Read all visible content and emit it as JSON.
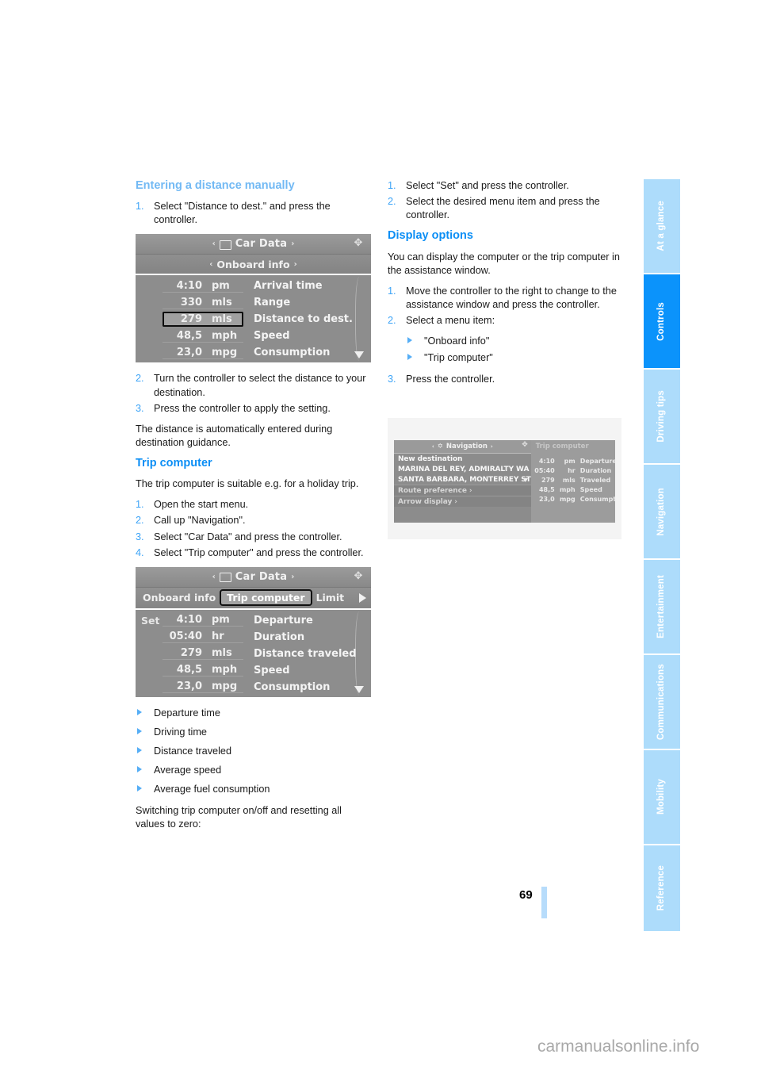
{
  "page": {
    "number": "69",
    "watermark": "carmanualsonline.info"
  },
  "side_tabs": [
    {
      "label": "At a glance",
      "active": false
    },
    {
      "label": "Controls",
      "active": true
    },
    {
      "label": "Driving tips",
      "active": false
    },
    {
      "label": "Navigation",
      "active": false
    },
    {
      "label": "Entertainment",
      "active": false
    },
    {
      "label": "Communications",
      "active": false
    },
    {
      "label": "Mobility",
      "active": false
    },
    {
      "label": "Reference",
      "active": false
    }
  ],
  "left_column": {
    "heading_entering": "Entering a distance manually",
    "steps_entering_1": [
      "Select \"Distance to dest.\" and press the controller."
    ],
    "steps_entering_2": [
      "Turn the controller to select the distance to your destination.",
      "Press the controller to apply the setting."
    ],
    "para_distance_auto": "The distance is automatically entered during destination guidance.",
    "heading_trip": "Trip computer",
    "para_trip_intro": "The trip computer is suitable e.g. for a holiday trip.",
    "steps_trip": [
      "Open the start menu.",
      "Call up \"Navigation\".",
      "Select \"Car Data\" and press the controller.",
      "Select \"Trip computer\" and press the controller."
    ],
    "trip_values": [
      "Departure time",
      "Driving time",
      "Distance traveled",
      "Average speed",
      "Average fuel consumption"
    ],
    "para_switching": "Switching trip computer on/off and resetting all values to zero:"
  },
  "right_column": {
    "steps_set": [
      "Select \"Set\" and press the controller.",
      "Select the desired menu item and press the controller."
    ],
    "heading_display": "Display options",
    "para_display": "You can display the computer or the trip computer in the assistance window.",
    "steps_display": [
      "Move the controller to the right to change to the assistance window and press the controller.",
      "Select a menu item:",
      "Press the controller."
    ],
    "menu_items": [
      "\"Onboard info\"",
      "\"Trip computer\""
    ]
  },
  "screens": {
    "onboard_info": {
      "title": "Car Data",
      "subtitle": "Onboard info",
      "caret_left": "‹",
      "caret_right": "›",
      "rows": [
        {
          "value": "4:10",
          "unit": "pm",
          "label": "Arrival time",
          "highlight": false
        },
        {
          "value": "330",
          "unit": "mls",
          "label": "Range",
          "highlight": false
        },
        {
          "value": "279",
          "unit": "mls",
          "label": "Distance to dest.",
          "highlight": true
        },
        {
          "value": "48,5",
          "unit": "mph",
          "label": "Speed",
          "highlight": false
        },
        {
          "value": "23,0",
          "unit": "mpg",
          "label": "Consumption",
          "highlight": false
        }
      ]
    },
    "trip_computer": {
      "title": "Car Data",
      "tabs": [
        "Onboard info",
        "Trip computer",
        "Limit"
      ],
      "selected_tab": "Trip computer",
      "set_label": "Set",
      "rows": [
        {
          "value": "4:10",
          "unit": "pm",
          "label": "Departure"
        },
        {
          "value": "05:40",
          "unit": "hr",
          "label": "Duration"
        },
        {
          "value": "279",
          "unit": "mls",
          "label": "Distance traveled"
        },
        {
          "value": "48,5",
          "unit": "mph",
          "label": "Speed"
        },
        {
          "value": "23,0",
          "unit": "mpg",
          "label": "Consumption"
        }
      ]
    },
    "navigation": {
      "title": "Navigation",
      "items": [
        "New destination",
        "MARINA DEL REY, ADMIRALTY WA",
        "SANTA BARBARA, MONTERREY ST"
      ],
      "dim_items": [
        "Route preference ›",
        "Arrow display ›"
      ],
      "assistance_title": "Trip computer",
      "assistance_rows": [
        {
          "value": "4:10",
          "unit": "pm",
          "label": "Departure"
        },
        {
          "value": "05:40",
          "unit": "hr",
          "label": "Duration"
        },
        {
          "value": "279",
          "unit": "mls",
          "label": "Traveled"
        },
        {
          "value": "48,5",
          "unit": "mph",
          "label": "Speed"
        },
        {
          "value": "23,0",
          "unit": "mpg",
          "label": "Consumpt."
        }
      ]
    }
  },
  "colors": {
    "accent_light": "#72b9f4",
    "accent_bright": "#0b8ef5",
    "tab_inactive": "#addcfb",
    "tab_active": "#0b93fb"
  }
}
